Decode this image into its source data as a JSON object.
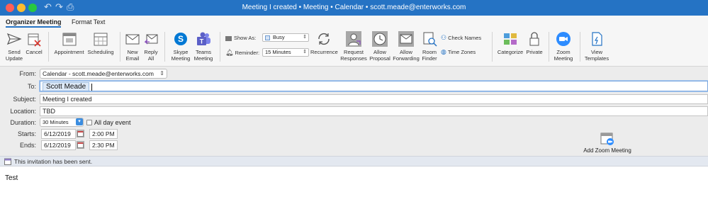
{
  "window": {
    "title": "Meeting I created • Meeting • Calendar • scott.meade@enterworks.com"
  },
  "ribbon_tabs": [
    {
      "label": "Organizer Meeting",
      "active": true
    },
    {
      "label": "Format Text",
      "active": false
    }
  ],
  "ribbon": {
    "send_update": "Send\nUpdate",
    "cancel": "Cancel",
    "appointment": "Appointment",
    "scheduling": "Scheduling",
    "new_email": "New\nEmail",
    "reply_all": "Reply\nAll",
    "skype_meeting": "Skype\nMeeting",
    "teams_meeting": "Teams\nMeeting",
    "show_as_label": "Show As:",
    "show_as_value": "Busy",
    "reminder_label": "Reminder:",
    "reminder_value": "15 Minutes",
    "recurrence": "Recurrence",
    "request_responses": "Request\nResponses",
    "allow_proposal": "Allow\nProposal",
    "allow_forwarding": "Allow\nForwarding",
    "room_finder": "Room\nFinder",
    "check_names": "Check Names",
    "time_zones": "Time Zones",
    "categorize": "Categorize",
    "private": "Private",
    "zoom_meeting": "Zoom\nMeeting",
    "view_templates": "View\nTemplates"
  },
  "form": {
    "from_label": "From:",
    "from_value": "Calendar - scott.meade@enterworks.com",
    "to_label": "To:",
    "to_value": "Scott Meade",
    "subject_label": "Subject:",
    "subject_value": "Meeting I created",
    "location_label": "Location:",
    "location_value": "TBD",
    "duration_label": "Duration:",
    "duration_value": "30 Minutes",
    "all_day_label": "All day event",
    "starts_label": "Starts:",
    "start_date": "6/12/2019",
    "start_time": "2:00 PM",
    "ends_label": "Ends:",
    "end_date": "6/12/2019",
    "end_time": "2:30 PM",
    "add_zoom_meeting": "Add Zoom Meeting"
  },
  "info_bar": {
    "text": "This invitation has been sent."
  },
  "body": {
    "text": "Test"
  },
  "colors": {
    "accent": "#2573c4",
    "skype": "#0078d4",
    "teams": "#5b5fc7",
    "zoom": "#2d8cff"
  }
}
